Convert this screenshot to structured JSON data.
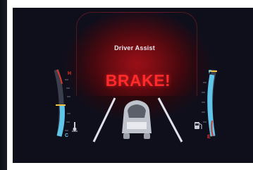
{
  "screen": {
    "title": "Driver Assist",
    "alert": "BRAKE!"
  },
  "gauges": {
    "left": {
      "name": "temperature-gauge",
      "high_label": "H",
      "low_label": "C",
      "level": 0.45
    },
    "right": {
      "name": "fuel-gauge",
      "high_label": "F",
      "low_label": "E",
      "level": 0.8
    }
  },
  "colors": {
    "alert": "#ff2a2a",
    "gauge_fill": "#5fc6ea",
    "high_mark": "#e0352c"
  }
}
